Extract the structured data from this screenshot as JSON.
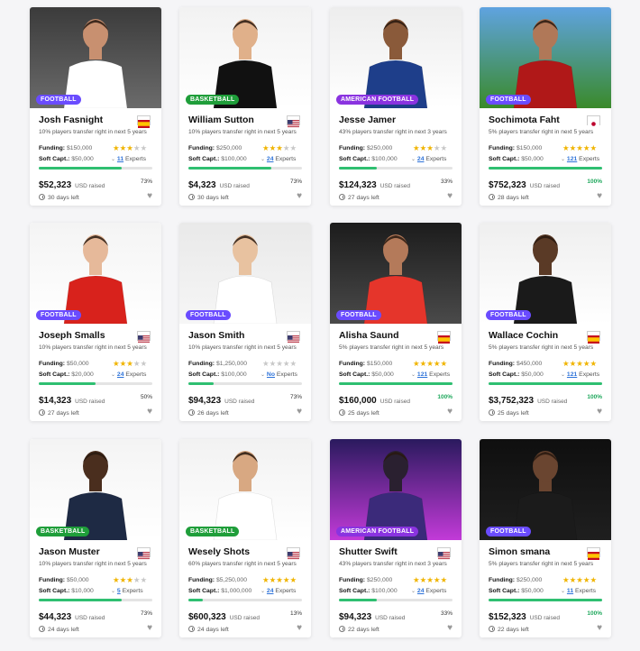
{
  "colors": {
    "football": "#6a4cff",
    "basketball": "#1f9e3a",
    "american_football": "#8a33e0",
    "progress": "#2fbf71",
    "star": "#f0b400",
    "link": "#2e73d9"
  },
  "labels": {
    "funding": "Funding:",
    "soft_capt": "Soft Capt.:",
    "experts": "Experts",
    "usd_raised": "USD raised"
  },
  "cards": [
    {
      "name": "Josh Fasnight",
      "sport": "FOOTBALL",
      "sport_key": "football",
      "flag": "spain",
      "subtitle": "10% players transfer right in next 5 years",
      "funding": "$150,000",
      "soft_capt": "$50,000",
      "stars": 3,
      "experts": "11",
      "raised": "$52,323",
      "percent": "73%",
      "progress": 0.73,
      "days": "30 days left"
    },
    {
      "name": "William Sutton",
      "sport": "BASKETBALL",
      "sport_key": "basketball",
      "flag": "usa",
      "subtitle": "10% players transfer right in next 5 years",
      "funding": "$250,000",
      "soft_capt": "$100,000",
      "stars": 3,
      "experts": "24",
      "raised": "$4,323",
      "percent": "73%",
      "progress": 0.73,
      "days": "30 days left"
    },
    {
      "name": "Jesse Jamer",
      "sport": "AMERICAN FOOTBALL",
      "sport_key": "american_football",
      "flag": "",
      "subtitle": "43% players transfer right in next 3 years",
      "funding": "$250,000",
      "soft_capt": "$100,000",
      "stars": 3,
      "experts": "24",
      "raised": "$124,323",
      "percent": "33%",
      "progress": 0.33,
      "days": "27 days left"
    },
    {
      "name": "Sochimota Faht",
      "sport": "FOOTBALL",
      "sport_key": "football",
      "flag": "japan",
      "subtitle": "5% players transfer right in next 5 years",
      "funding": "$150,000",
      "soft_capt": "$50,000",
      "stars": 5,
      "experts": "121",
      "raised": "$752,323",
      "percent": "100%",
      "progress": 1.0,
      "days": "28 days left"
    },
    {
      "name": "Joseph Smalls",
      "sport": "FOOTBALL",
      "sport_key": "football",
      "flag": "usa",
      "subtitle": "10% players transfer right in next 5 years",
      "funding": "$50,000",
      "soft_capt": "$20,000",
      "stars": 3,
      "experts": "24",
      "raised": "$14,323",
      "percent": "50%",
      "progress": 0.5,
      "days": "27 days left"
    },
    {
      "name": "Jason Smith",
      "sport": "FOOTBALL",
      "sport_key": "football",
      "flag": "usa",
      "subtitle": "10% players transfer right in next 5 years",
      "funding": "$1,250,000",
      "soft_capt": "$100,000",
      "stars": 0,
      "experts": "No",
      "raised": "$94,323",
      "percent": "73%",
      "progress": 0.22,
      "days": "26 days left"
    },
    {
      "name": "Alisha Saund",
      "sport": "FOOTBALL",
      "sport_key": "football",
      "flag": "spain",
      "subtitle": "5% players transfer right in next 5 years",
      "funding": "$150,000",
      "soft_capt": "$50,000",
      "stars": 5,
      "experts": "121",
      "raised": "$160,000",
      "percent": "100%",
      "progress": 1.0,
      "days": "25 days left"
    },
    {
      "name": "Wallace Cochin",
      "sport": "FOOTBALL",
      "sport_key": "football",
      "flag": "spain",
      "subtitle": "5% players transfer right in next 5 years",
      "funding": "$450,000",
      "soft_capt": "$50,000",
      "stars": 5,
      "experts": "121",
      "raised": "$3,752,323",
      "percent": "100%",
      "progress": 1.0,
      "days": "25 days left"
    },
    {
      "name": "Jason Muster",
      "sport": "BASKETBALL",
      "sport_key": "basketball",
      "flag": "usa",
      "subtitle": "10% players transfer right in next 5 years",
      "funding": "$50,000",
      "soft_capt": "$10,000",
      "stars": 3,
      "experts": "5",
      "raised": "$44,323",
      "percent": "73%",
      "progress": 0.73,
      "days": "24 days left"
    },
    {
      "name": "Wesely Shots",
      "sport": "BASKETBALL",
      "sport_key": "basketball",
      "flag": "usa",
      "subtitle": "60% players transfer right in next 5 years",
      "funding": "$5,250,000",
      "soft_capt": "$1,000,000",
      "stars": 5,
      "experts": "24",
      "raised": "$600,323",
      "percent": "13%",
      "progress": 0.13,
      "days": "24 days left"
    },
    {
      "name": "Shutter Swift",
      "sport": "AMERICAN FOOTBALL",
      "sport_key": "american_football",
      "flag": "usa",
      "subtitle": "43% players transfer right in next 3 years",
      "funding": "$250,000",
      "soft_capt": "$100,000",
      "stars": 5,
      "experts": "24",
      "raised": "$94,323",
      "percent": "33%",
      "progress": 0.33,
      "days": "22 days left"
    },
    {
      "name": "Simon smana",
      "sport": "FOOTBALL",
      "sport_key": "football",
      "flag": "spain",
      "subtitle": "5% players transfer right in next 5 years",
      "funding": "$250,000",
      "soft_capt": "$50,000",
      "stars": 5,
      "experts": "11",
      "raised": "$152,323",
      "percent": "100%",
      "progress": 1.0,
      "days": "22 days left"
    }
  ]
}
